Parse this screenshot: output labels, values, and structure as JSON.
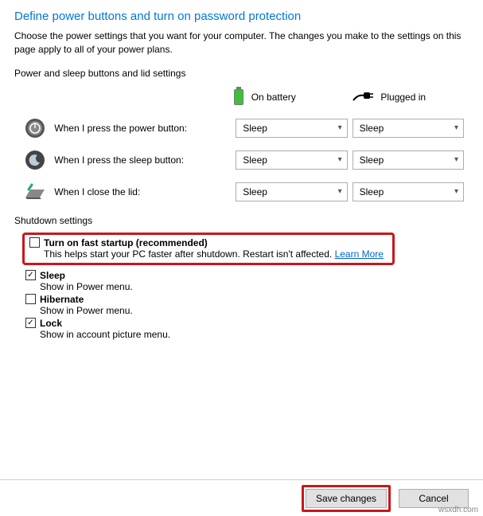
{
  "heading": "Define power buttons and turn on password protection",
  "description": "Choose the power settings that you want for your computer. The changes you make to the settings on this page apply to all of your power plans.",
  "section_buttons_label": "Power and sleep buttons and lid settings",
  "columns": {
    "battery": "On battery",
    "plugged": "Plugged in"
  },
  "rows": [
    {
      "label": "When I press the power button:",
      "battery": "Sleep",
      "plugged": "Sleep"
    },
    {
      "label": "When I press the sleep button:",
      "battery": "Sleep",
      "plugged": "Sleep"
    },
    {
      "label": "When I close the lid:",
      "battery": "Sleep",
      "plugged": "Sleep"
    }
  ],
  "shutdown_label": "Shutdown settings",
  "shutdown": {
    "fast_startup": {
      "label": "Turn on fast startup (recommended)",
      "desc": "This helps start your PC faster after shutdown. Restart isn't affected. ",
      "link": "Learn More",
      "checked": false
    },
    "sleep": {
      "label": "Sleep",
      "desc": "Show in Power menu.",
      "checked": true
    },
    "hibernate": {
      "label": "Hibernate",
      "desc": "Show in Power menu.",
      "checked": false
    },
    "lock": {
      "label": "Lock",
      "desc": "Show in account picture menu.",
      "checked": true
    }
  },
  "footer": {
    "save": "Save changes",
    "cancel": "Cancel"
  },
  "watermark": "wsxdh.com"
}
